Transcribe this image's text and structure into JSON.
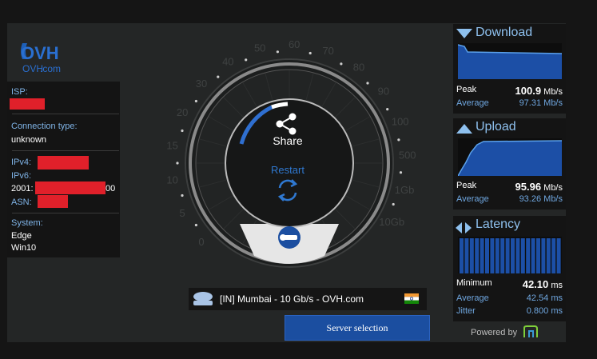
{
  "logo": {
    "mark": "OVH",
    "sub": ".com"
  },
  "info": {
    "isp_label": "ISP:",
    "conn_label": "Connection type:",
    "conn_value": "unknown",
    "ipv4_label": "IPv4:",
    "ipv6_label": "IPv6:",
    "ipv6_prefix": "2001:",
    "ipv6_suffix": "00",
    "asn_label": "ASN:",
    "system_label": "System:",
    "system_browser": "Edge",
    "system_os": "Win10"
  },
  "gauge": {
    "ticks": [
      "0",
      "5",
      "10",
      "15",
      "20",
      "30",
      "40",
      "50",
      "60",
      "70",
      "80",
      "90",
      "100",
      "500",
      "1Gb",
      "10Gb"
    ],
    "share_label": "Share",
    "restart_label": "Restart"
  },
  "download": {
    "title": "Download",
    "peak_label": "Peak",
    "peak_value": "100.9",
    "peak_unit": "Mb/s",
    "avg_label": "Average",
    "avg_value": "97.31",
    "avg_unit": "Mb/s"
  },
  "upload": {
    "title": "Upload",
    "peak_label": "Peak",
    "peak_value": "95.96",
    "peak_unit": "Mb/s",
    "avg_label": "Average",
    "avg_value": "93.26",
    "avg_unit": "Mb/s"
  },
  "latency": {
    "title": "Latency",
    "min_label": "Minimum",
    "min_value": "42.10",
    "min_unit": "ms",
    "avg_label": "Average",
    "avg_value": "42.54",
    "avg_unit": "ms",
    "jitter_label": "Jitter",
    "jitter_value": "0.800",
    "jitter_unit": "ms"
  },
  "server": {
    "name": "[IN] Mumbai - 10 Gb/s - OVH.com",
    "button_label": "Server selection"
  },
  "footer": {
    "powered_by": "Powered by"
  },
  "colors": {
    "accent": "#1b4ea0",
    "label_blue": "#7fb3e6",
    "redaction": "#e0202a"
  }
}
